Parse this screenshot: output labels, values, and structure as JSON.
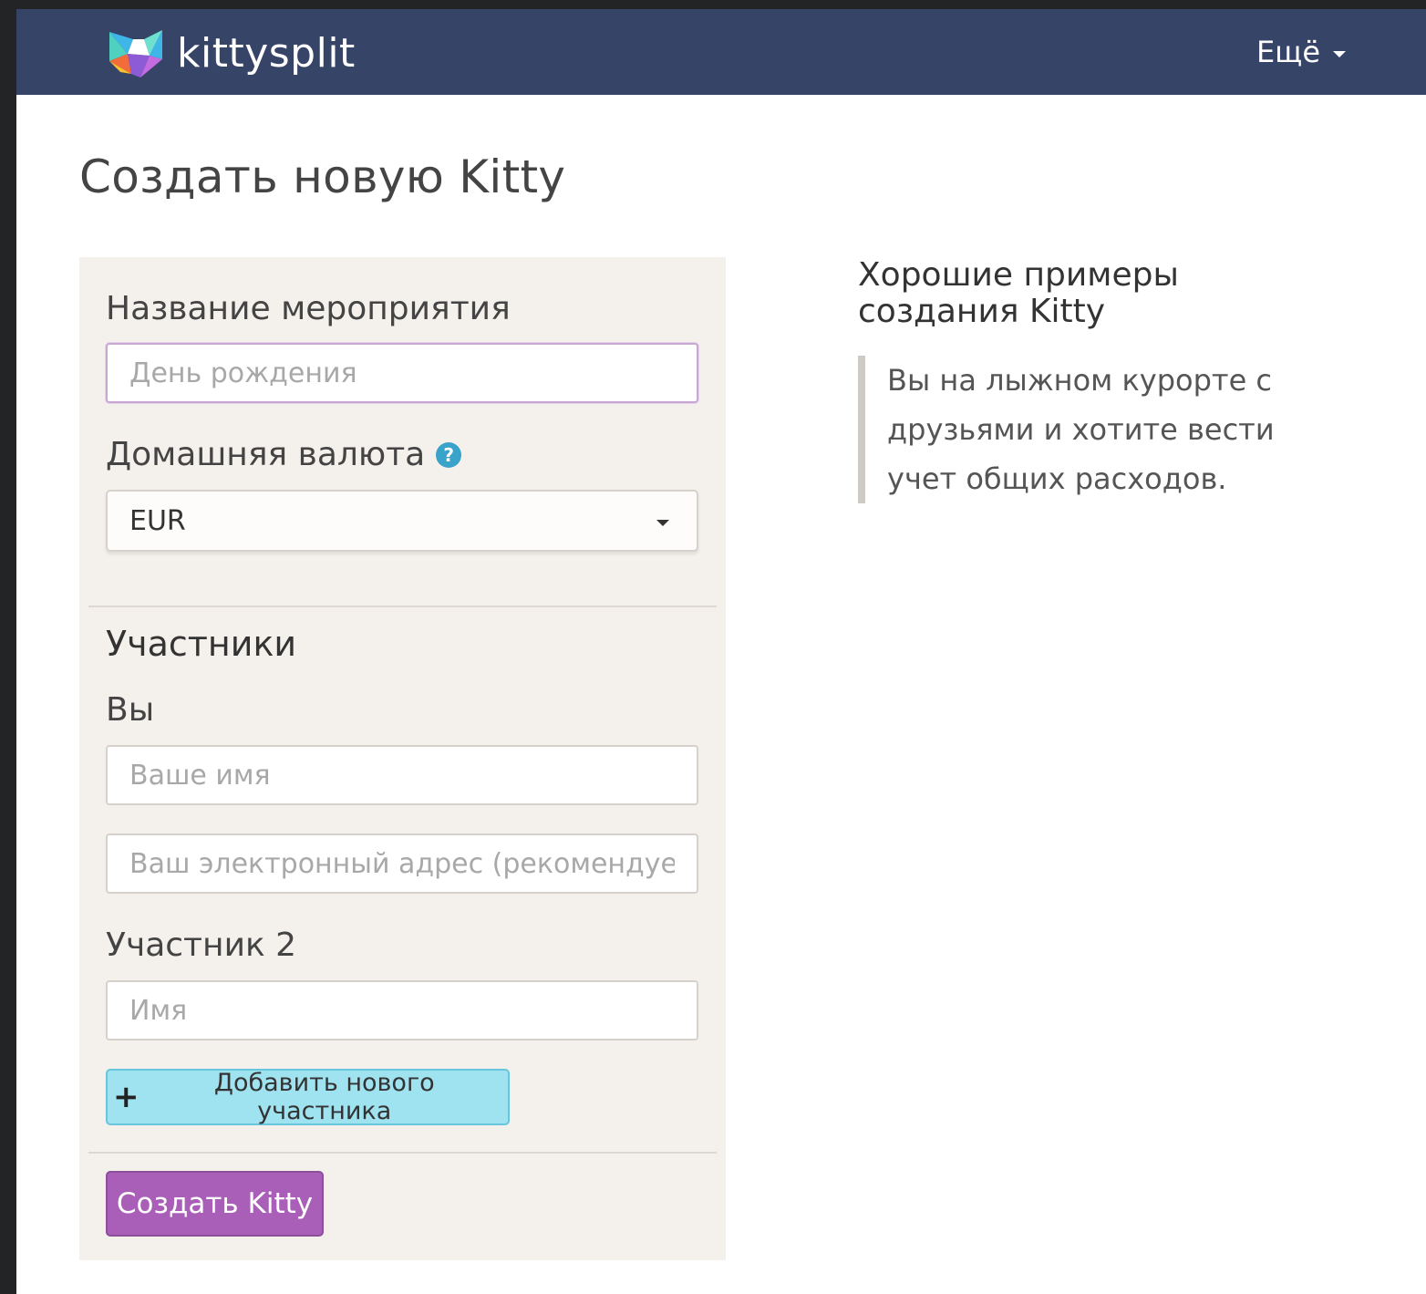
{
  "navbar": {
    "brand_name": "kittysplit",
    "more_label": "Ещё"
  },
  "page": {
    "title": "Создать новую Kitty"
  },
  "form": {
    "event_name_label": "Название мероприятия",
    "event_name_placeholder": "День рождения",
    "currency_label": "Домашняя валюта",
    "currency_value": "EUR",
    "participants_title": "Участники",
    "you_label": "Вы",
    "your_name_placeholder": "Ваше имя",
    "your_email_placeholder": "Ваш электронный адрес (рекомендуется)",
    "participant2_label": "Участник 2",
    "participant2_name_placeholder": "Имя",
    "add_participant_label": "Добавить нового участника",
    "create_button_label": "Создать Kitty"
  },
  "sidebar": {
    "examples_title": "Хорошие примеры создания Kitty",
    "example_text": "Вы на лыжном курорте с друзьями и хотите вести учет общих расходов."
  },
  "colors": {
    "navbar_bg": "#364468",
    "panel_bg": "#f4f1ec",
    "add_button_bg": "#9fe3f0",
    "create_button_bg": "#a95fb7",
    "help_icon": "#3aa3c9"
  }
}
